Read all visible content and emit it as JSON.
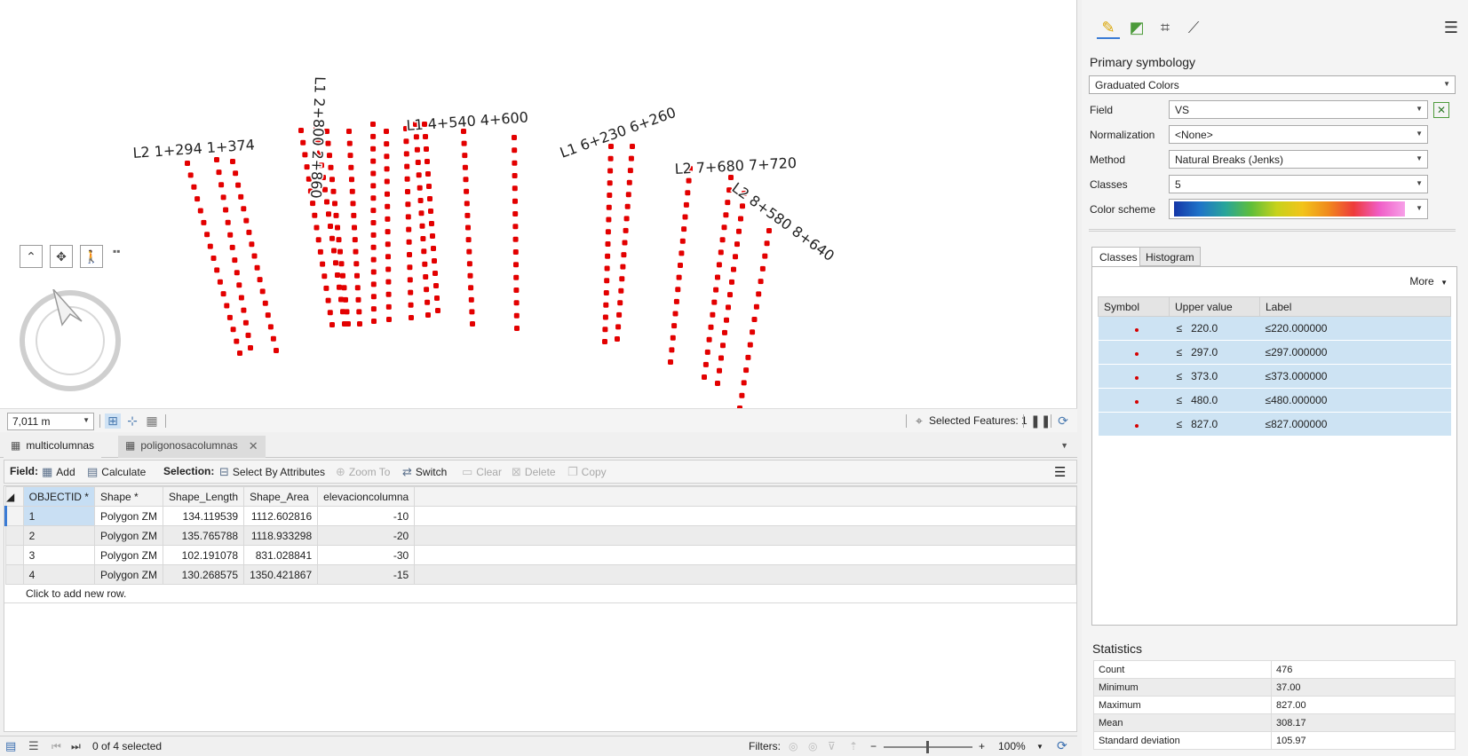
{
  "map": {
    "labels": [
      "L2 1+294 1+374",
      "L1 2+800 2+860",
      "L1 4+540 4+600",
      "L1 6+230 6+260",
      "L2 7+680 7+720",
      "L2 8+580 8+640"
    ],
    "point_color": "#e30000",
    "scale_value": "7,011 m",
    "selected_features": "Selected Features: 1"
  },
  "tabs": [
    {
      "label": "multicolumnas"
    },
    {
      "label": "poligonosacolumnas"
    }
  ],
  "toolbar": {
    "field_label": "Field:",
    "add": "Add",
    "calculate": "Calculate",
    "selection_label": "Selection:",
    "select_by_attributes": "Select By Attributes",
    "zoom_to": "Zoom To",
    "switch": "Switch",
    "clear": "Clear",
    "delete": "Delete",
    "copy": "Copy"
  },
  "table": {
    "columns": [
      "OBJECTID *",
      "Shape *",
      "Shape_Length",
      "Shape_Area",
      "elevacioncolumna"
    ],
    "rows": [
      [
        "1",
        "Polygon ZM",
        "134.119539",
        "1112.602816",
        "-10"
      ],
      [
        "2",
        "Polygon ZM",
        "135.765788",
        "1118.933298",
        "-20"
      ],
      [
        "3",
        "Polygon ZM",
        "102.191078",
        "831.028841",
        "-30"
      ],
      [
        "4",
        "Polygon ZM",
        "130.268575",
        "1350.421867",
        "-15"
      ]
    ],
    "add_row": "Click to add new row."
  },
  "status": {
    "selected": "0 of 4 selected",
    "filters": "Filters:",
    "zoom": "100%"
  },
  "panel": {
    "primary_symbology": "Primary symbology",
    "renderer": "Graduated Colors",
    "field_label": "Field",
    "field_value": "VS",
    "normalization_label": "Normalization",
    "normalization_value": "<None>",
    "method_label": "Method",
    "method_value": "Natural Breaks (Jenks)",
    "classes_label": "Classes",
    "classes_value": "5",
    "color_scheme_label": "Color scheme",
    "tab_classes": "Classes",
    "tab_histogram": "Histogram",
    "more": "More",
    "class_columns": [
      "Symbol",
      "Upper value",
      "Label"
    ],
    "classes": [
      {
        "op": "≤",
        "upper": "220.0",
        "label": "≤220.000000"
      },
      {
        "op": "≤",
        "upper": "297.0",
        "label": "≤297.000000"
      },
      {
        "op": "≤",
        "upper": "373.0",
        "label": "≤373.000000"
      },
      {
        "op": "≤",
        "upper": "480.0",
        "label": "≤480.000000"
      },
      {
        "op": "≤",
        "upper": "827.0",
        "label": "≤827.000000"
      }
    ],
    "statistics_title": "Statistics",
    "statistics": [
      {
        "name": "Count",
        "value": "476"
      },
      {
        "name": "Minimum",
        "value": "37.00"
      },
      {
        "name": "Maximum",
        "value": "827.00"
      },
      {
        "name": "Mean",
        "value": "308.17"
      },
      {
        "name": "Standard deviation",
        "value": "105.97"
      }
    ]
  }
}
